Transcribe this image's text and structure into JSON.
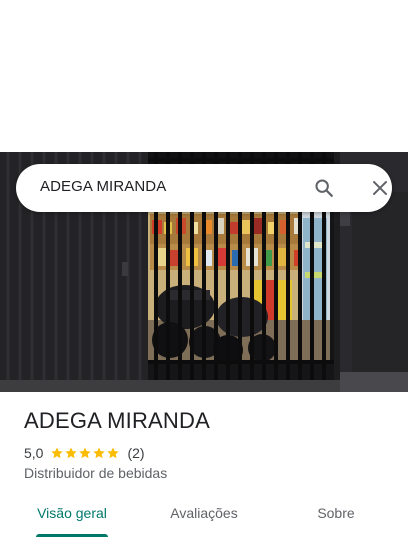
{
  "search": {
    "query": "ADEGA MIRANDA",
    "search_icon": "search-icon",
    "close_icon": "close-icon"
  },
  "photo": {
    "subject": "storefront-photo"
  },
  "place": {
    "name": "ADEGA MIRANDA",
    "rating": "5,0",
    "stars": 5,
    "review_count": "(2)",
    "category": "Distribuidor de bebidas"
  },
  "tabs": [
    {
      "label": "Visão geral",
      "active": true
    },
    {
      "label": "Avaliações",
      "active": false
    },
    {
      "label": "Sobre",
      "active": false
    }
  ],
  "colors": {
    "accent": "#00796b",
    "star": "#fbbc04",
    "text": "#202124",
    "secondary": "#5f6368"
  }
}
